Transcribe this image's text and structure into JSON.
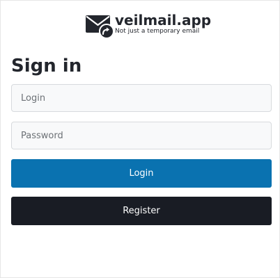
{
  "brand": {
    "name": "veilmail.app",
    "tagline": "Not just a temporary email",
    "icon": "envelope-forward-icon",
    "color": "#23262d"
  },
  "page": {
    "title": "Sign in"
  },
  "form": {
    "login_placeholder": "Login",
    "login_value": "",
    "password_placeholder": "Password",
    "password_value": "",
    "login_button": "Login",
    "register_button": "Register"
  },
  "colors": {
    "login_button": "#0a72b0",
    "register_button": "#191c24",
    "input_background": "#f8f9fa",
    "input_border": "#d7dadd"
  }
}
